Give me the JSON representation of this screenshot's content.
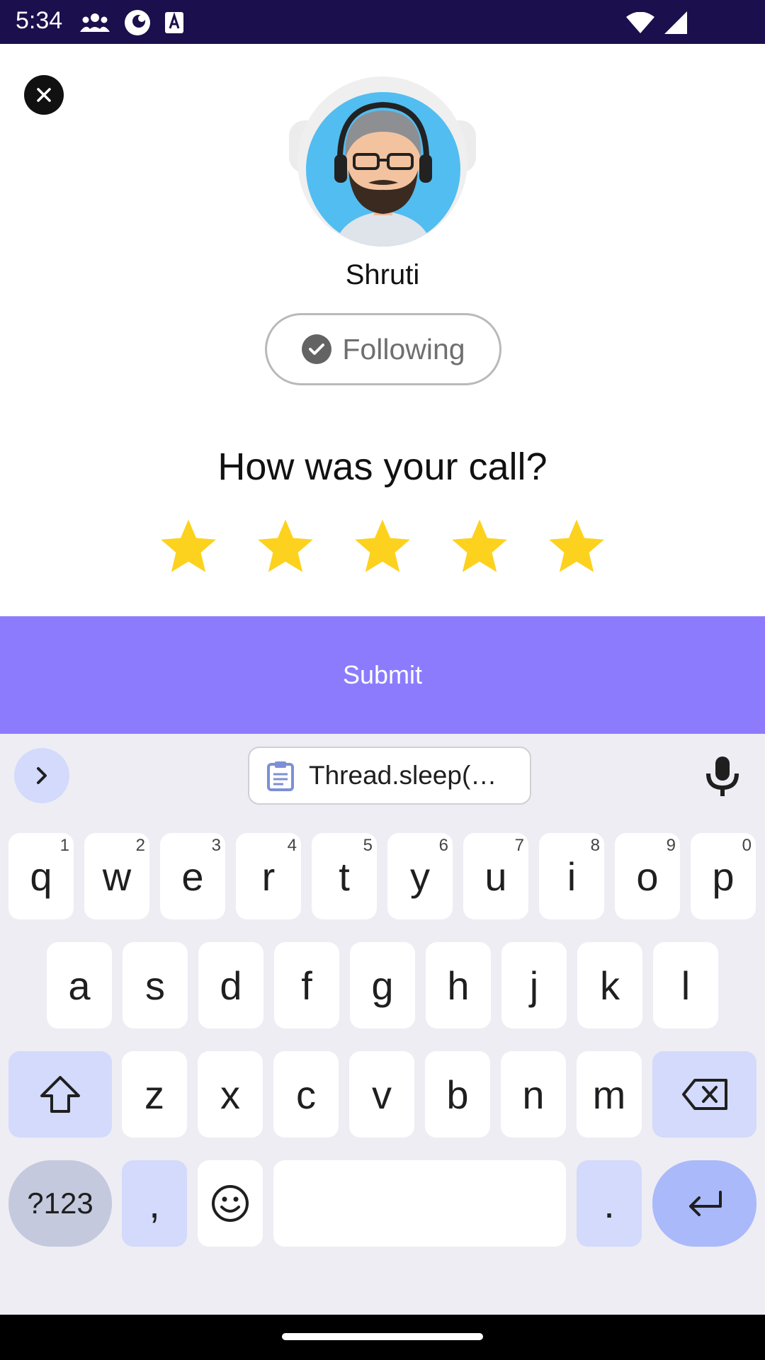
{
  "status_bar": {
    "time": "5:34"
  },
  "profile": {
    "name": "Shruti",
    "follow_label": "Following"
  },
  "rating": {
    "question": "How was your call?",
    "value": 5,
    "max": 5
  },
  "submit_label": "Submit",
  "keyboard": {
    "clipboard_text": "Thread.sleep(…",
    "row1": [
      {
        "k": "q",
        "h": "1"
      },
      {
        "k": "w",
        "h": "2"
      },
      {
        "k": "e",
        "h": "3"
      },
      {
        "k": "r",
        "h": "4"
      },
      {
        "k": "t",
        "h": "5"
      },
      {
        "k": "y",
        "h": "6"
      },
      {
        "k": "u",
        "h": "7"
      },
      {
        "k": "i",
        "h": "8"
      },
      {
        "k": "o",
        "h": "9"
      },
      {
        "k": "p",
        "h": "0"
      }
    ],
    "row2": [
      "a",
      "s",
      "d",
      "f",
      "g",
      "h",
      "j",
      "k",
      "l"
    ],
    "row3": [
      "z",
      "x",
      "c",
      "v",
      "b",
      "n",
      "m"
    ],
    "symbols_label": "?123",
    "comma_label": ",",
    "period_label": "."
  },
  "colors": {
    "status_bar": "#1b0f4d",
    "submit": "#8c7cfd",
    "star": "#fcd21e",
    "avatar_bg": "#52bdf0"
  }
}
